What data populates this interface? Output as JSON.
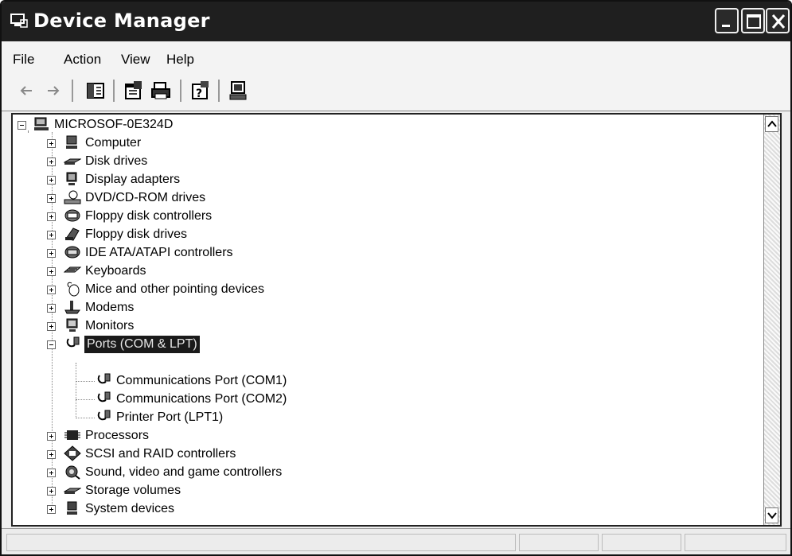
{
  "window": {
    "title": "Device Manager"
  },
  "menu": [
    "File",
    "Action",
    "View",
    "Help"
  ],
  "toolbar": {
    "buttons": [
      "back-icon",
      "forward-icon",
      "console-tree-icon",
      "properties-icon",
      "print-icon",
      "help-icon",
      "scan-hardware-icon"
    ]
  },
  "tree": {
    "root": "MICROSOF-0E324D",
    "categories": [
      "Computer",
      "Disk drives",
      "Display adapters",
      "DVD/CD-ROM drives",
      "Floppy disk controllers",
      "Floppy disk drives",
      "IDE ATA/ATAPI controllers",
      "Keyboards",
      "Mice and other pointing devices",
      "Modems",
      "Monitors",
      "Ports (COM & LPT)",
      "Processors",
      "SCSI and RAID controllers",
      "Sound, video and game controllers",
      "Storage volumes",
      "System devices"
    ],
    "expanded_category": "Ports (COM & LPT)",
    "ports_children": [
      "Communications Port (COM1)",
      "Communications Port (COM2)",
      "Printer Port (LPT1)"
    ]
  }
}
